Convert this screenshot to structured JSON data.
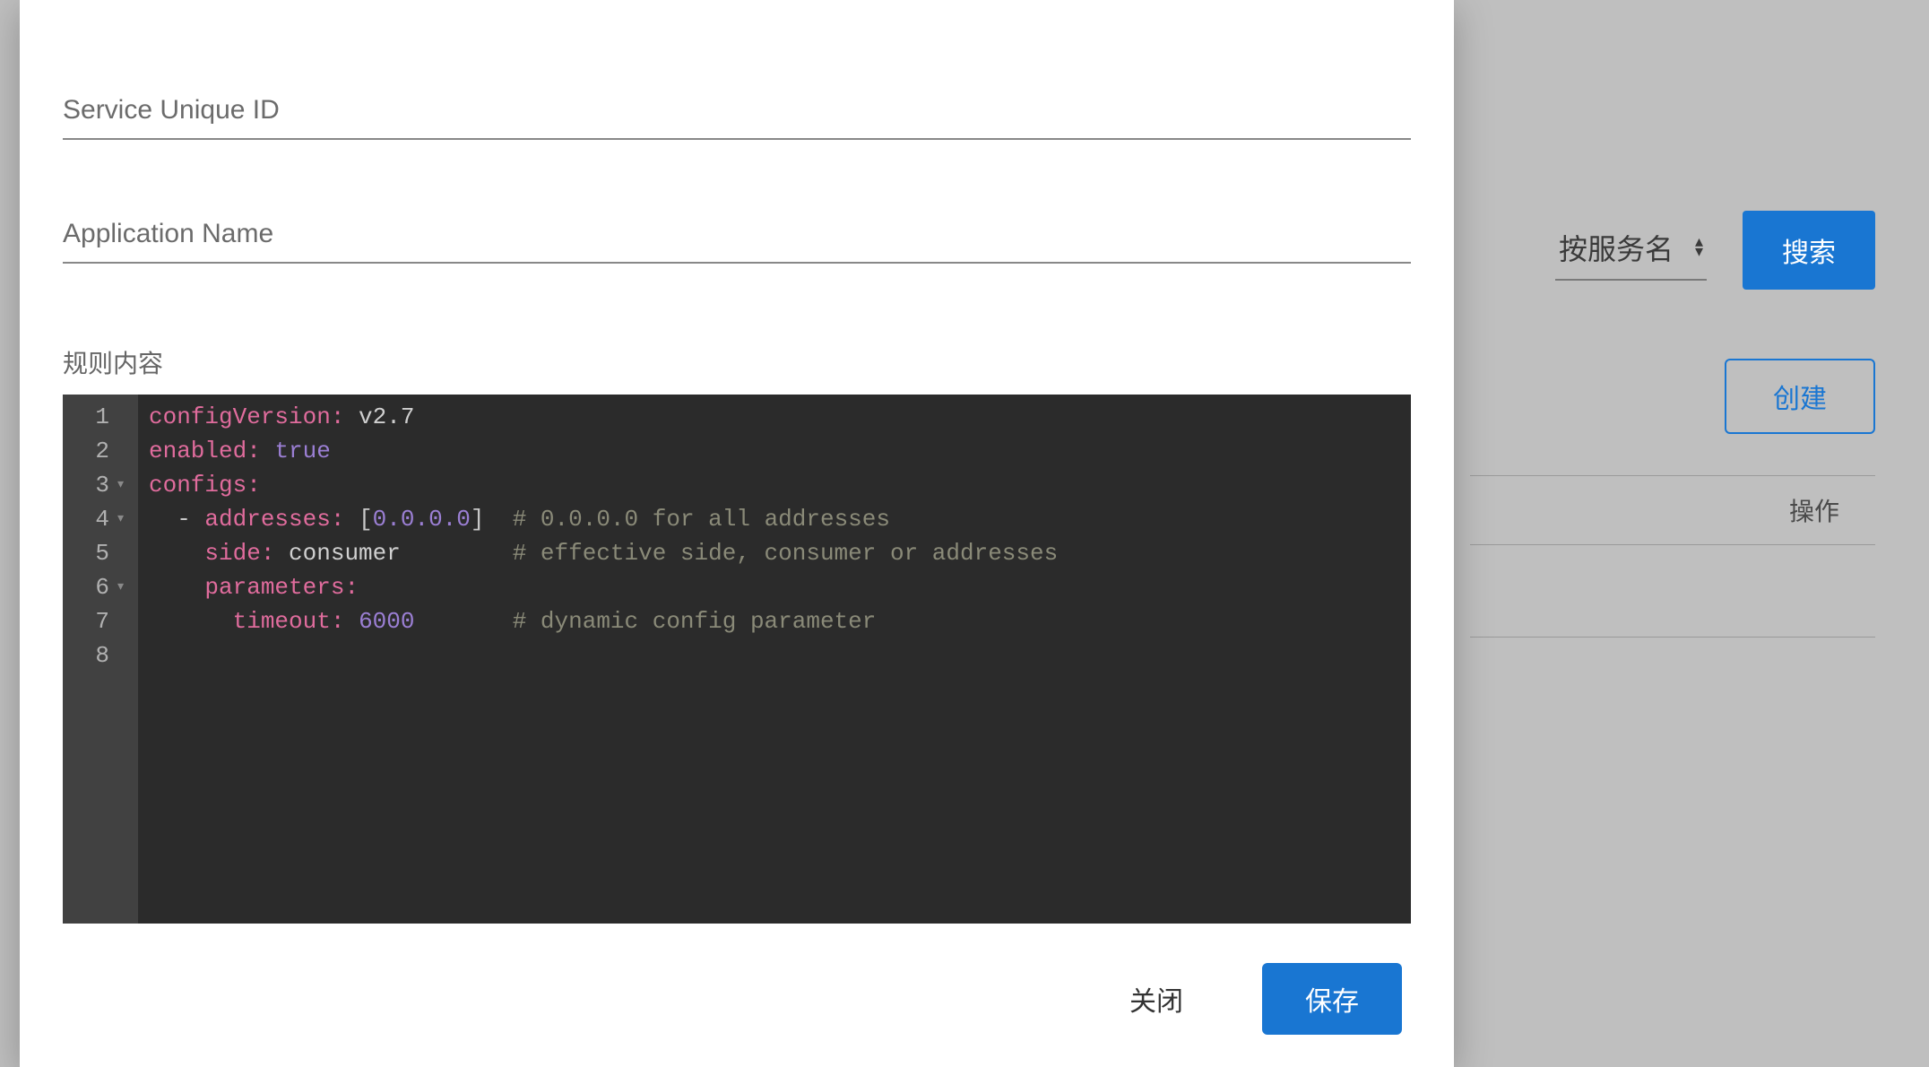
{
  "background": {
    "filter_select": "按服务名",
    "search_button": "搜索",
    "create_button": "创建",
    "table_header_action": "操作"
  },
  "modal": {
    "fields": {
      "service_id_placeholder": "Service Unique ID",
      "service_id_value": "",
      "app_name_placeholder": "Application Name",
      "app_name_value": ""
    },
    "rule_label": "规则内容",
    "editor": {
      "gutter": [
        "1",
        "2",
        "3",
        "4",
        "5",
        "6",
        "7",
        "8"
      ],
      "fold_lines": [
        3,
        4,
        6
      ],
      "lines": [
        {
          "tokens": [
            {
              "t": "configVersion:",
              "c": "tok-key"
            },
            {
              "t": " ",
              "c": ""
            },
            {
              "t": "v2.7",
              "c": "tok-str"
            }
          ]
        },
        {
          "tokens": [
            {
              "t": "enabled:",
              "c": "tok-key"
            },
            {
              "t": " ",
              "c": ""
            },
            {
              "t": "true",
              "c": "tok-bool"
            }
          ]
        },
        {
          "tokens": [
            {
              "t": "configs:",
              "c": "tok-key"
            }
          ]
        },
        {
          "tokens": [
            {
              "t": "  - ",
              "c": "tok-punc"
            },
            {
              "t": "addresses:",
              "c": "tok-key"
            },
            {
              "t": " ",
              "c": ""
            },
            {
              "t": "[",
              "c": "tok-punc"
            },
            {
              "t": "0.0.0.0",
              "c": "tok-ip"
            },
            {
              "t": "]",
              "c": "tok-punc"
            },
            {
              "t": "  ",
              "c": ""
            },
            {
              "t": "# 0.0.0.0 for all addresses",
              "c": "tok-comment"
            }
          ]
        },
        {
          "tokens": [
            {
              "t": "    ",
              "c": ""
            },
            {
              "t": "side:",
              "c": "tok-key"
            },
            {
              "t": " ",
              "c": ""
            },
            {
              "t": "consumer",
              "c": "tok-str"
            },
            {
              "t": "        ",
              "c": ""
            },
            {
              "t": "# effective side, consumer or addresses",
              "c": "tok-comment"
            }
          ]
        },
        {
          "tokens": [
            {
              "t": "    ",
              "c": ""
            },
            {
              "t": "parameters:",
              "c": "tok-key"
            }
          ]
        },
        {
          "tokens": [
            {
              "t": "      ",
              "c": ""
            },
            {
              "t": "timeout:",
              "c": "tok-key"
            },
            {
              "t": " ",
              "c": ""
            },
            {
              "t": "6000",
              "c": "tok-num"
            },
            {
              "t": "       ",
              "c": ""
            },
            {
              "t": "# dynamic config parameter",
              "c": "tok-comment"
            }
          ]
        },
        {
          "tokens": []
        }
      ]
    },
    "actions": {
      "close": "关闭",
      "save": "保存"
    }
  }
}
